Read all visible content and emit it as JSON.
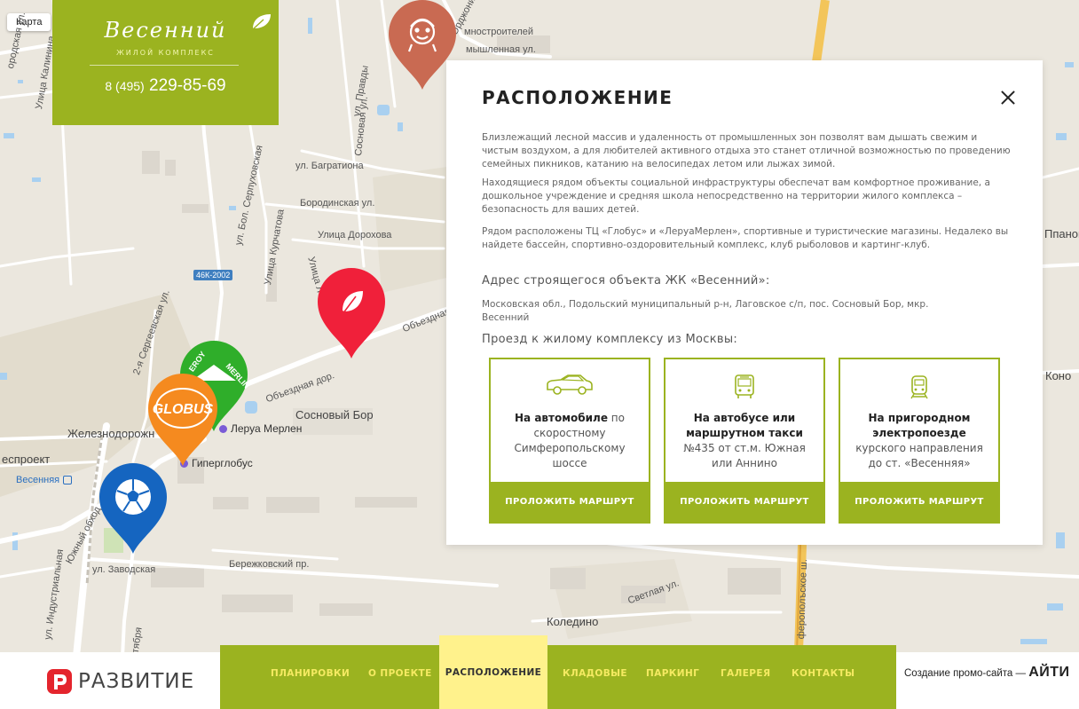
{
  "map": {
    "chip_label": "Карта",
    "labels": {
      "gorodskaya": "ородская ул.",
      "kalinina": "Улица Калинина",
      "pravdy": "ул. Правды",
      "ordzhonikidze": "Орджоникидзе",
      "promyshlennaya": "мышленная ул.",
      "mnostroiteley": "мностроителей",
      "sosnovaya": "Сосновая ул.",
      "bagrationa": "ул. Багратиона",
      "borodinskaya": "Бородинская ул.",
      "dorohova": "Улица Дорохова",
      "bol_serpukhovskaya": "ул. Бол. Серпуховская",
      "kurchatova": "Улица Курчатова",
      "ulitsa_l": "Улица Л",
      "sergeevskaya": "2-я Сергеевская ул.",
      "obezdnaya": "Объездная",
      "obezdnaya_dor": "Объездная дор.",
      "sosnovy_bor": "Сосновый Бор",
      "zheleznodorozh": "Железнодорожн",
      "lesproekt": "еспроект",
      "yuzhny": "Южный обход",
      "industrialnaya": "ул. Индустриальная",
      "zavodskaya": "ул. Заводская",
      "oktyabrya": "ктября",
      "berezhkovsky": "Бережковский пр.",
      "svetlaya": "Светлая ул.",
      "koledino": "Коледино",
      "simferopolskoe": "ферополъское ш.",
      "pan": "Ппанон",
      "kono": "Коно"
    },
    "road_badge": "46К-2002",
    "pois": {
      "leroy": "Леруа Мерлен",
      "giperglobus": "Гиперглобус",
      "station": "Весенняя"
    },
    "pins": {
      "leroy_text": "MERLIN",
      "leroy_text2": "EROY",
      "globus_text": "GLOBUS"
    }
  },
  "logo": {
    "name": "Весенний",
    "subtitle": "ЖИЛОЙ КОМПЛЕКС",
    "phone_code": "8 (495)",
    "phone_number": "229-85-69"
  },
  "panel": {
    "title": "РАСПОЛОЖЕНИЕ",
    "paragraphs": [
      "Близлежащий лесной массив и удаленность от промышленных зон позволят вам дышать свежим и чистым воздухом, а для любителей активного отдыха это станет отличной возможностью по проведению семейных пикников, катанию на велосипедах летом или лыжах зимой.",
      "Находящиеся рядом объекты социальной инфраструктуры обеспечат вам комфортное проживание, а дошкольное учреждение и средняя школа непосредственно на территории жилого комплекса – безопасность для ваших детей.",
      "Рядом расположены ТЦ «Глобус» и «ЛеруаМерлен», спортивные и туристические магазины. Недалеко вы найдете бассейн, спортивно-оздоровительный комплекс, клуб рыболовов и картинг-клуб."
    ],
    "address_heading": "Адрес строящегося объекта ЖК «Весенний»:",
    "address": "Московская обл., Подольский муниципальный р-н, Лаговское с/п, пос. Сосновый Бор, мкр. Весенний",
    "route_heading": "Проезд к жилому комплексу из Москвы:",
    "cards": [
      {
        "icon": "car-icon",
        "bold": "На автомобиле",
        "rest": " по скоростному Симферопольскому шоссе",
        "button": "ПРОЛОЖИТЬ МАРШРУТ"
      },
      {
        "icon": "bus-icon",
        "bold": "На автобусе или маршрутном такси",
        "rest": " №435 от ст.м. Южная или Аннино",
        "button": "ПРОЛОЖИТЬ МАРШРУТ"
      },
      {
        "icon": "train-icon",
        "bold": "На пригородном электропоезде",
        "rest": " курского направления до ст. «Весенняя»",
        "button": "ПРОЛОЖИТЬ МАРШРУТ"
      }
    ]
  },
  "footer": {
    "brand": "РАЗВИТИЕ",
    "nav": [
      "ПЛАНИРОВКИ",
      "О ПРОЕКТЕ",
      "РАСПОЛОЖЕНИЕ",
      "КЛАДОВЫЕ",
      "ПАРКИНГ",
      "ГАЛЕРЕЯ",
      "КОНТАКТЫ"
    ],
    "credit_text": "Создание промо-сайта — ",
    "credit_brand": "АЙТИ"
  },
  "colors": {
    "accent": "#9bb320",
    "nav_active": "#fff28c",
    "nav_text": "#f5ea62",
    "pin_red": "#f0203a",
    "pin_green": "#2fae2a",
    "pin_orange": "#f58a1f",
    "pin_blue": "#1565c0",
    "pin_brown": "#c96a52"
  }
}
